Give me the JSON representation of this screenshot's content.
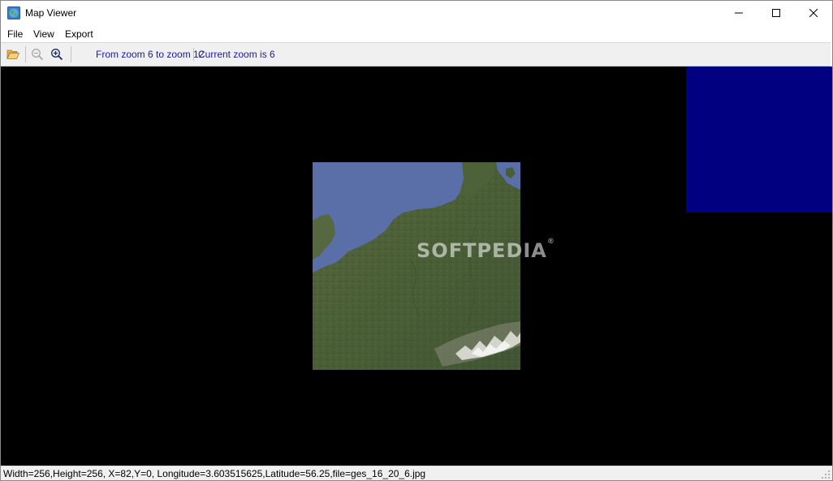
{
  "window": {
    "title": "Map Viewer",
    "app_icon": "map-globe-icon",
    "controls": {
      "minimize_icon": "minimize-icon",
      "maximize_icon": "maximize-icon",
      "close_icon": "close-icon"
    }
  },
  "menu": {
    "items": [
      "File",
      "View",
      "Export"
    ]
  },
  "toolbar": {
    "open_icon": "folder-open-icon",
    "zoom_out_icon": "zoom-out-icon",
    "zoom_in_icon": "zoom-in-icon",
    "zoom_range_label": "From zoom 6 to zoom 12",
    "current_zoom_label": "Current zoom is 6"
  },
  "map": {
    "background_color": "#000000",
    "tiles": [
      {
        "type": "placeholder",
        "color": "#000080"
      },
      {
        "type": "satellite",
        "region": "North Sea / Western Europe"
      }
    ],
    "watermark": "SOFTPEDIA",
    "watermark_mark": "®"
  },
  "status": {
    "text": "Width=256,Height=256, X=82,Y=0, Longitude=3.603515625,Latitude=56.25,file=ges_16_20_6.jpg"
  },
  "colors": {
    "toolbar_label": "#1a1aa6",
    "placeholder_tile": "#000080",
    "sea": "#5a6fa8",
    "land": "#4a5e3a"
  }
}
